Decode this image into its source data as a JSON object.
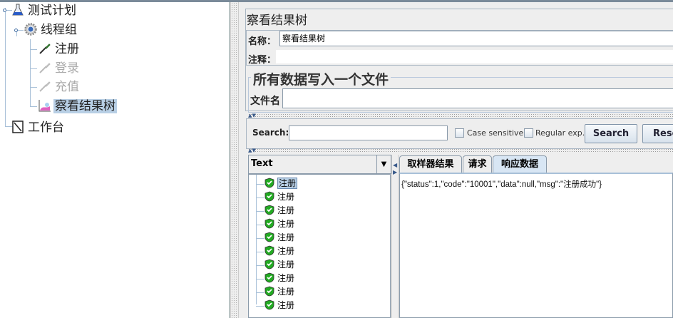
{
  "tree": {
    "items": [
      {
        "label": "测试计划",
        "icon": "flask-icon"
      },
      {
        "label": "线程组",
        "icon": "gear-icon"
      },
      {
        "label": "注册",
        "icon": "dropper-icon",
        "enabled": true
      },
      {
        "label": "登录",
        "icon": "dropper-icon",
        "enabled": false
      },
      {
        "label": "充值",
        "icon": "dropper-icon",
        "enabled": false
      },
      {
        "label": "察看结果树",
        "icon": "chart-icon",
        "selected": true
      },
      {
        "label": "工作台",
        "icon": "notepad-icon"
      }
    ]
  },
  "panel": {
    "title": "察看结果树",
    "name_label": "名称：",
    "name_value": "察看结果树",
    "comment_label": "注释：",
    "file_section_title": "所有数据写入一个文件",
    "filename_label": "文件名"
  },
  "search": {
    "label": "Search:",
    "value": "",
    "case_sensitive": "Case sensitive",
    "regex": "Regular exp.",
    "search_button": "Search",
    "reset_button": "Rese"
  },
  "results": {
    "renderer": "Text",
    "samples": [
      "注册",
      "注册",
      "注册",
      "注册",
      "注册",
      "注册",
      "注册",
      "注册",
      "注册",
      "注册"
    ],
    "tabs": [
      "取样器结果",
      "请求",
      "响应数据"
    ],
    "active_tab": 2,
    "response": "{\"status\":1,\"code\":\"10001\",\"data\":null,\"msg\":\"注册成功\"}"
  },
  "colors": {
    "selection": "#b8cfe5",
    "success": "#22aa22"
  }
}
